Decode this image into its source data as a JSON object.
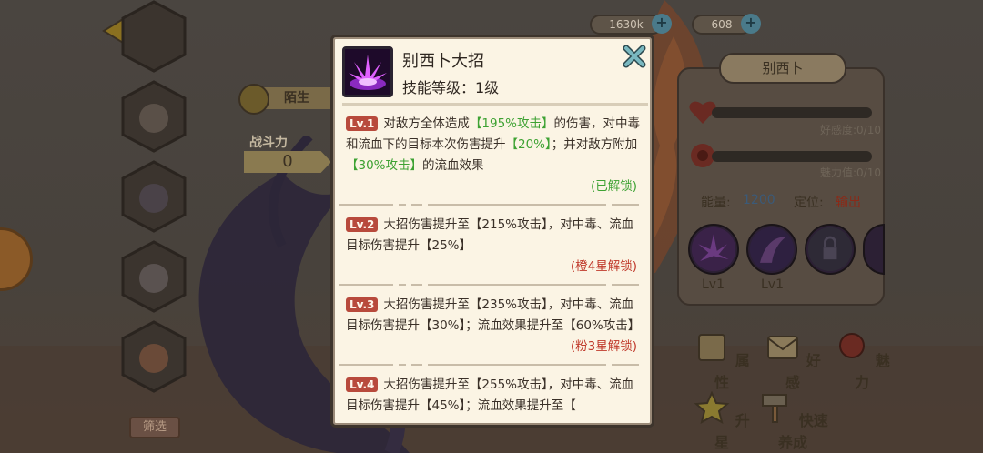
{
  "background": {
    "currencies": [
      {
        "value": "1630k"
      },
      {
        "value": "608"
      }
    ],
    "stranger_label": "陌生",
    "power": {
      "label": "战斗力",
      "value": "0"
    },
    "filter_label": "筛选",
    "hero_panel": {
      "name": "别西卜",
      "affection_label": "好感度:0/10",
      "charm_label": "魅力值:0/10",
      "energy_label": "能量:",
      "energy_value": "1200",
      "role_label": "定位:",
      "role_value": "输出",
      "skills": [
        {
          "level": "Lv1"
        },
        {
          "level": "Lv1"
        }
      ]
    },
    "actions": [
      {
        "label": "属性",
        "icon": "scroll-icon"
      },
      {
        "label": "好感",
        "icon": "letter-icon"
      },
      {
        "label": "魅力",
        "icon": "rose-icon"
      },
      {
        "label": "升星",
        "icon": "star-icon"
      },
      {
        "label": "快速养成",
        "icon": "hammer-icon"
      }
    ]
  },
  "modal": {
    "skill_name": "别西卜大招",
    "skill_level": "技能等级：1级",
    "levels": [
      {
        "tag": "Lv.1",
        "segments": [
          {
            "text": "对敌方全体造成",
            "hl": false
          },
          {
            "text": "【195%攻击】",
            "hl": true
          },
          {
            "text": "的伤害，对中毒和流血下的目标本次伤害提升",
            "hl": false
          },
          {
            "text": "【20%】",
            "hl": true
          },
          {
            "text": "；并对敌方附加",
            "hl": false
          },
          {
            "text": "【30%攻击】",
            "hl": true
          },
          {
            "text": "的流血效果",
            "hl": false
          }
        ],
        "status": "(已解锁)",
        "unlocked": true
      },
      {
        "tag": "Lv.2",
        "segments": [
          {
            "text": "大招伤害提升至【215%攻击】，对中毒、流血目标伤害提升【25%】",
            "hl": false
          }
        ],
        "status": "(橙4星解锁)",
        "unlocked": false
      },
      {
        "tag": "Lv.3",
        "segments": [
          {
            "text": "大招伤害提升至【235%攻击】，对中毒、流血目标伤害提升【30%】；流血效果提升至【60%攻击】",
            "hl": false
          }
        ],
        "status": "(粉3星解锁)",
        "unlocked": false
      },
      {
        "tag": "Lv.4",
        "segments": [
          {
            "text": "大招伤害提升至【255%攻击】，对中毒、流血目标伤害提升【45%】；流血效果提升至【",
            "hl": false
          }
        ],
        "status": "",
        "unlocked": false
      }
    ]
  },
  "colors": {
    "highlight_green": "#3ea233",
    "locked_red": "#c0392b",
    "level_tag": "#b84a3c",
    "modal_bg": "#fbf4e4"
  }
}
